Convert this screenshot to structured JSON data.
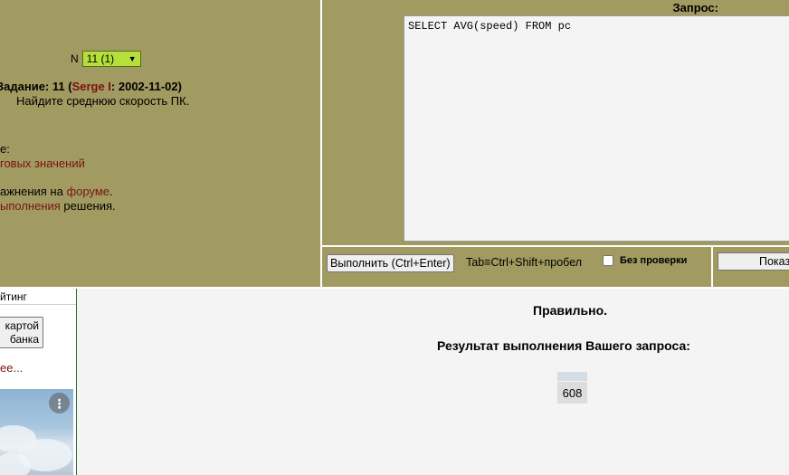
{
  "task": {
    "n_label": "N",
    "selected": "11 (1)",
    "title_prefix": "Задание: 11 (",
    "author": "Serge I",
    "title_date": ": 2002-11-02)",
    "text": "Найдите среднюю скорость ПК."
  },
  "left_lines": {
    "line1": "е:",
    "line2": "говых значений",
    "line3_pre": "ажнения на ",
    "line3_link": "форуме",
    "line3_post": ".",
    "line4_link": "ыполнения",
    "line4_post": " решения."
  },
  "editor": {
    "label": "Запрос:",
    "sql": "SELECT AVG(speed) FROM pc"
  },
  "toolbar": {
    "execute_label": "Выполнить (Ctrl+Enter)",
    "tab_hint": "Tab≡Ctrl+Shift+пробел",
    "no_check_label": "Без проверки",
    "show_label": "Показ"
  },
  "sidebar": {
    "rating_label": "йтинг",
    "card_button_line1": "картой",
    "card_button_line2": "банка",
    "more_link": "ее..."
  },
  "result": {
    "status": "Правильно.",
    "title": "Результат выполнения Вашего запроса:",
    "value": "608"
  },
  "colors": {
    "panel": "#a19b61",
    "select_bg": "#b5e03a",
    "link": "#7a1414"
  }
}
